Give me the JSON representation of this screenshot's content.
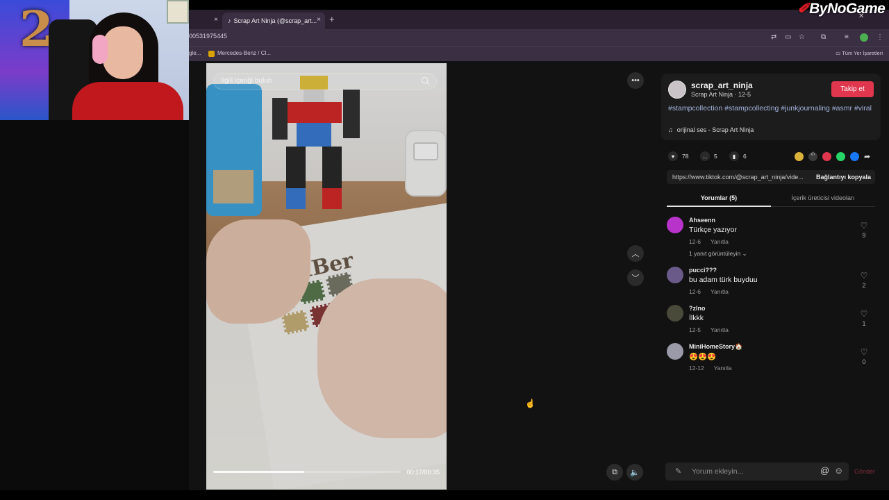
{
  "overlay": {
    "brand_logo": "ByNoGame"
  },
  "browser": {
    "tabs": [
      {
        "label": "",
        "close": "×"
      },
      {
        "label": "Scrap Art Ninja (@scrap_art...",
        "close": "×"
      }
    ],
    "new_tab": "+",
    "url": "00531975445",
    "bookmarks": [
      "gle...",
      "Mercedes-Benz / Cl..."
    ],
    "all_bookmarks": "Tüm Yer İşaretleri"
  },
  "video": {
    "search_placeholder": "İlgili içeriği bulun",
    "time": "00:17/00:35",
    "progress": 0.486
  },
  "author": {
    "name": "scrap_art_ninja",
    "sub": "Scrap Art Ninja · 12-5",
    "follow_label": "Takip et",
    "hashtags": "#stampcollection #stampcollecting #junkjournaling #asmr #viral",
    "music": "orijinal ses - Scrap Art Ninja"
  },
  "actions": {
    "likes": "78",
    "comments": "5",
    "saves": "6"
  },
  "share_colors": [
    "#d9b23a",
    "#3a3a3a",
    "#e0374e",
    "#25d366",
    "#1877f2"
  ],
  "link": {
    "url": "https://www.tiktok.com/@scrap_art_ninja/vide...",
    "copy_label": "Bağlantıyı kopyala"
  },
  "tabs": {
    "comments": "Yorumlar (5)",
    "creator": "İçerik üreticisi videoları"
  },
  "comments": [
    {
      "user": "Ahseenn",
      "text": "Türkçe yazıyor",
      "date": "12-6",
      "reply": "Yanıtla",
      "likes": "9",
      "more": "1 yanıt görüntüleyin ⌄",
      "avatar": "#b833c9"
    },
    {
      "user": "pucci???",
      "text": "bu adam türk buyduu",
      "date": "12-6",
      "reply": "Yanıtla",
      "likes": "2",
      "more": "",
      "avatar": "#6a5a8a"
    },
    {
      "user": "?zlno",
      "text": "İlkkk",
      "date": "12-5",
      "reply": "Yanıtla",
      "likes": "1",
      "more": "",
      "avatar": "#4a4a3a"
    },
    {
      "user": "MiniHomeStory🏠",
      "text": "😍😍😍",
      "date": "12-12",
      "reply": "Yanıtla",
      "likes": "0",
      "more": "",
      "avatar": "#9a9aa8"
    }
  ],
  "composer": {
    "placeholder": "Yorum ekleyin...",
    "at": "@",
    "emoji": "☺",
    "send": "Gönder"
  }
}
